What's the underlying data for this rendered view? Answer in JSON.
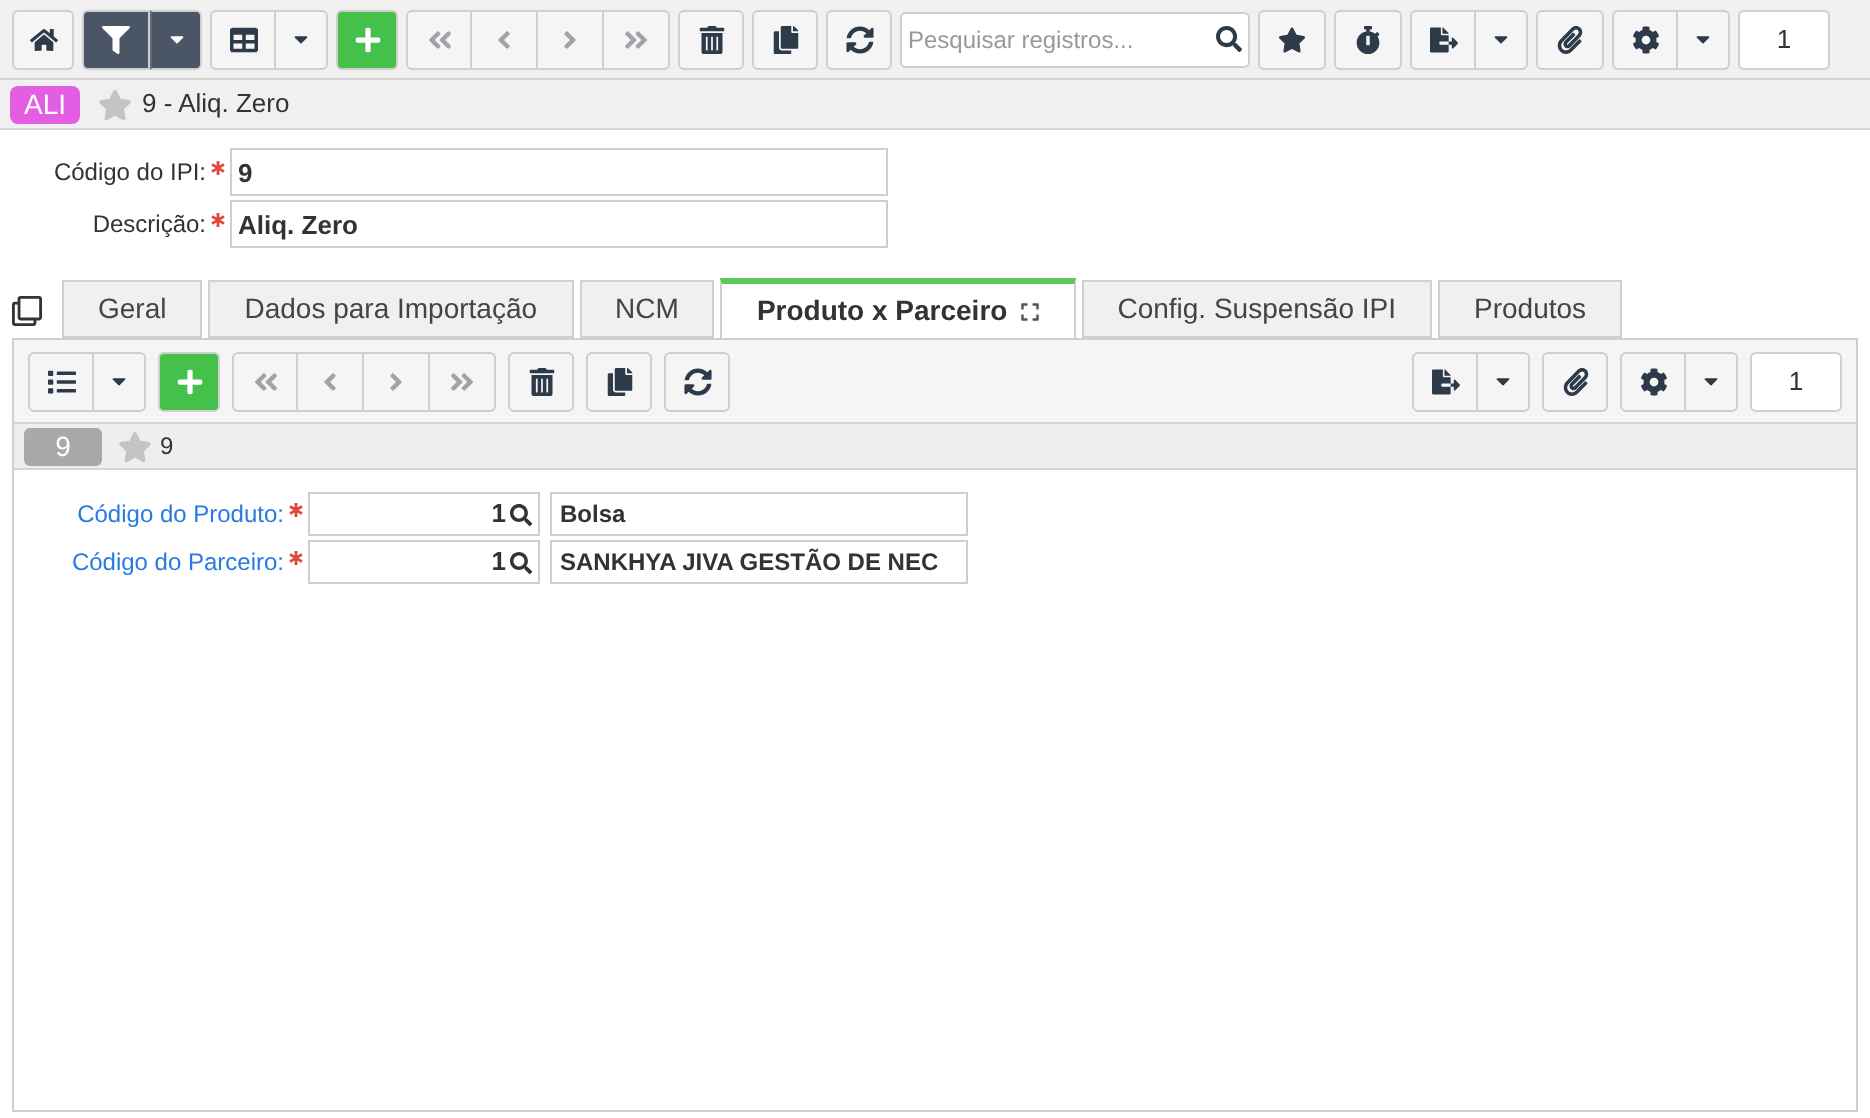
{
  "toolbar": {
    "search": {
      "placeholder": "Pesquisar registros..."
    },
    "page": "1"
  },
  "header": {
    "badge": "ALI",
    "favorite": false,
    "title": "9 - Aliq. Zero"
  },
  "form": {
    "fields": [
      {
        "label": "Código do IPI:",
        "required": true,
        "value": "9"
      },
      {
        "label": "Descrição:",
        "required": true,
        "value": "Aliq. Zero"
      }
    ]
  },
  "tabs": [
    {
      "label": "Geral",
      "selected": false
    },
    {
      "label": "Dados para Importação",
      "selected": false
    },
    {
      "label": "NCM",
      "selected": false
    },
    {
      "label": "Produto x Parceiro",
      "selected": true
    },
    {
      "label": "Config. Suspensão IPI",
      "selected": false
    },
    {
      "label": "Produtos",
      "selected": false
    }
  ],
  "detail": {
    "page": "1",
    "record_badge": "9",
    "favorite": false,
    "record_title": "9",
    "fields": [
      {
        "label": "Código do Produto:",
        "required": true,
        "code": "1",
        "description": "Bolsa"
      },
      {
        "label": "Código do Parceiro:",
        "required": true,
        "code": "1",
        "description": "SANKHYA JIVA GESTÃO DE NEC"
      }
    ]
  }
}
